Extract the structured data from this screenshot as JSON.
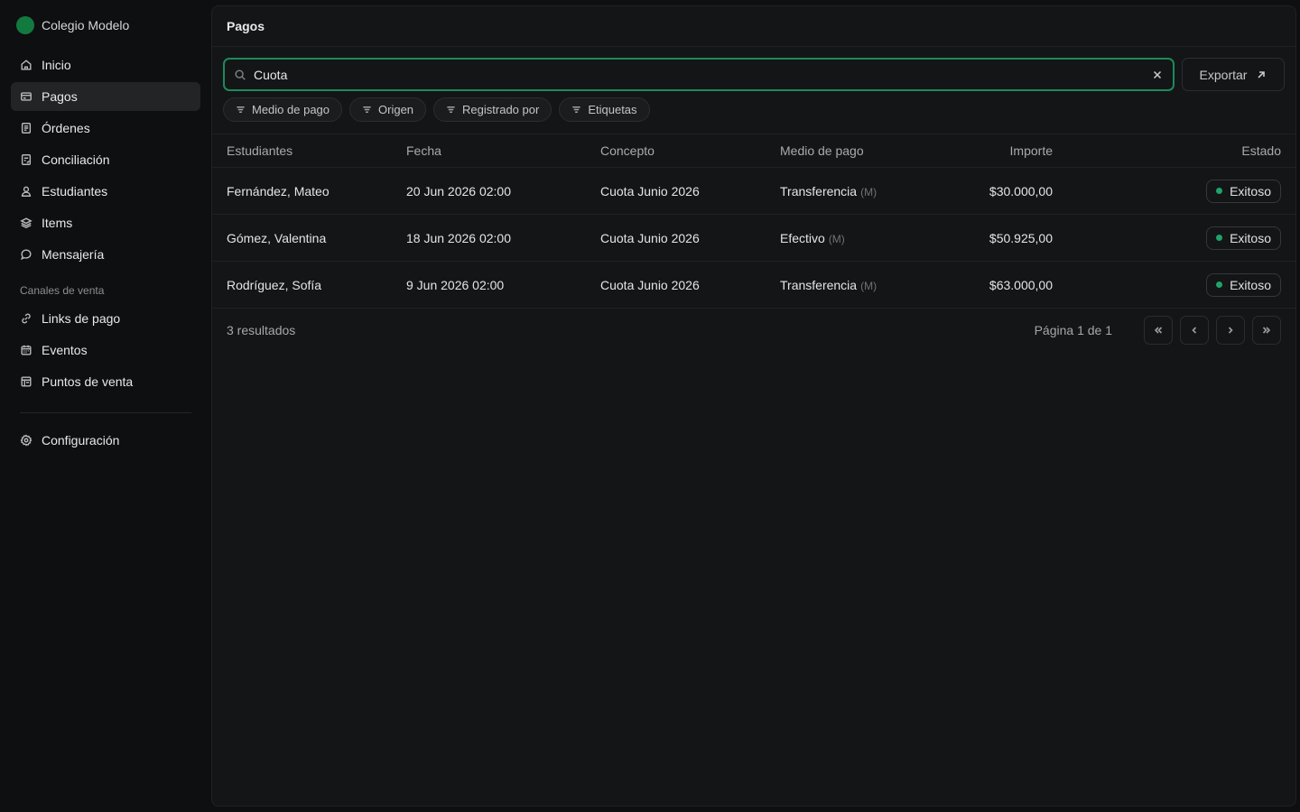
{
  "brand": {
    "name": "Colegio Modelo",
    "color": "#127a3e"
  },
  "sidebar": {
    "items": [
      {
        "label": "Inicio",
        "icon": "home-icon"
      },
      {
        "label": "Pagos",
        "icon": "card-icon",
        "active": true
      },
      {
        "label": "Órdenes",
        "icon": "orders-icon"
      },
      {
        "label": "Conciliación",
        "icon": "reconcile-icon"
      },
      {
        "label": "Estudiantes",
        "icon": "user-icon"
      },
      {
        "label": "Items",
        "icon": "layers-icon"
      },
      {
        "label": "Mensajería",
        "icon": "message-icon"
      }
    ],
    "section_label": "Canales de venta",
    "channels": [
      {
        "label": "Links de pago",
        "icon": "link-icon"
      },
      {
        "label": "Eventos",
        "icon": "calendar-icon"
      },
      {
        "label": "Puntos de venta",
        "icon": "store-icon"
      }
    ],
    "settings": {
      "label": "Configuración",
      "icon": "gear-icon"
    }
  },
  "header": {
    "title": "Pagos"
  },
  "search": {
    "value": "Cuota",
    "accent": "#1c8a5a"
  },
  "toolbar": {
    "export_label": "Exportar"
  },
  "filters": [
    "Medio de pago",
    "Origen",
    "Registrado por",
    "Etiquetas"
  ],
  "table": {
    "columns": [
      "Estudiantes",
      "Fecha",
      "Concepto",
      "Medio de pago",
      "Importe",
      "Estado"
    ],
    "rows": [
      {
        "student": "Fernández, Mateo",
        "date": "20 Jun 2026 02:00",
        "concept": "Cuota Junio 2026",
        "method": "Transferencia",
        "method_tag": "(M)",
        "amount": "$30.000,00",
        "status": "Exitoso"
      },
      {
        "student": "Gómez, Valentina",
        "date": "18 Jun 2026 02:00",
        "concept": "Cuota Junio 2026",
        "method": "Efectivo",
        "method_tag": "(M)",
        "amount": "$50.925,00",
        "status": "Exitoso"
      },
      {
        "student": "Rodríguez, Sofía",
        "date": "9 Jun 2026 02:00",
        "concept": "Cuota Junio 2026",
        "method": "Transferencia",
        "method_tag": "(M)",
        "amount": "$63.000,00",
        "status": "Exitoso"
      }
    ],
    "status_color": "#1fa36a"
  },
  "footer": {
    "results": "3 resultados",
    "page_label": "Página 1 de 1"
  }
}
